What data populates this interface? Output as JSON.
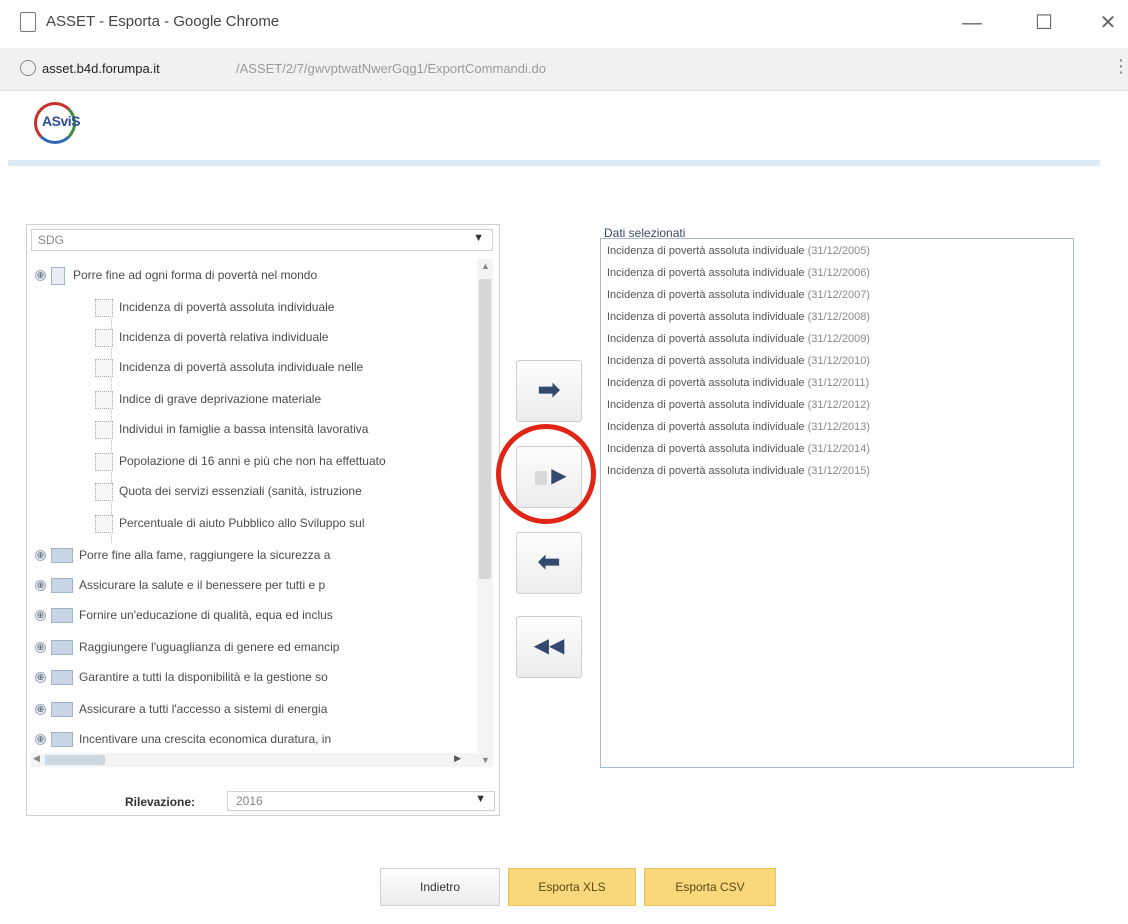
{
  "window": {
    "title": "ASSET - Esporta - Google Chrome",
    "minimize": "—",
    "maximize": "☐",
    "close": "✕"
  },
  "address": {
    "host": "asset.b4d.forumpa.it",
    "path": "/ASSET/2/7/gwvptwatNwerGqg1/ExportCommandi.do",
    "menu": "⋮"
  },
  "logo": {
    "text": "ASviS",
    "sub": ""
  },
  "left": {
    "group_select": "SDG",
    "tree": [
      {
        "type": "goal",
        "label": "Porre fine ad ogni forma di povertà nel mondo",
        "expander": "⊕"
      },
      {
        "type": "leaf",
        "label": "Incidenza di povertà assoluta individuale"
      },
      {
        "type": "leaf",
        "label": "Incidenza di povertà relativa individuale"
      },
      {
        "type": "leaf",
        "label": "Incidenza di povertà assoluta individuale nelle"
      },
      {
        "type": "leaf",
        "label": "Indice di grave deprivazione materiale"
      },
      {
        "type": "leaf",
        "label": "Individui in famiglie a bassa intensità lavorativa"
      },
      {
        "type": "leaf",
        "label": "Popolazione di 16 anni e più che non ha effettuato"
      },
      {
        "type": "leaf",
        "label": "Quota dei servizi essenziali (sanità, istruzione"
      },
      {
        "type": "leaf",
        "label": "Percentuale di aiuto Pubblico allo Sviluppo sul"
      },
      {
        "type": "goal",
        "label": "Porre fine alla fame, raggiungere la sicurezza a",
        "expander": "⊕"
      },
      {
        "type": "goal",
        "label": "Assicurare la salute e il benessere per tutti e p",
        "expander": "⊕"
      },
      {
        "type": "goal",
        "label": "Fornire un'educazione di qualità, equa ed inclus",
        "expander": "⊕"
      },
      {
        "type": "goal",
        "label": "Raggiungere l'uguaglianza di genere ed emancip",
        "expander": "⊕"
      },
      {
        "type": "goal",
        "label": "Garantire a tutti la disponibilità e la gestione so",
        "expander": "⊕"
      },
      {
        "type": "goal",
        "label": "Assicurare a tutti l'accesso a sistemi di energia",
        "expander": "⊕"
      },
      {
        "type": "goal",
        "label": "Incentivare una crescita economica duratura, in",
        "expander": "⊕"
      }
    ],
    "rilevazione_label": "Rilevazione:",
    "rilevazione_value": "2016"
  },
  "middle": {
    "add_icon": "➡",
    "add_all_icon": "▶",
    "remove_icon": "⬅",
    "remove_all_icon": "◀◀"
  },
  "right": {
    "title": "Dati selezionati",
    "items": [
      {
        "name": "Incidenza di povertà assoluta individuale",
        "date": "(31/12/2005)"
      },
      {
        "name": "Incidenza di povertà assoluta individuale",
        "date": "(31/12/2006)"
      },
      {
        "name": "Incidenza di povertà assoluta individuale",
        "date": "(31/12/2007)"
      },
      {
        "name": "Incidenza di povertà assoluta individuale",
        "date": "(31/12/2008)"
      },
      {
        "name": "Incidenza di povertà assoluta individuale",
        "date": "(31/12/2009)"
      },
      {
        "name": "Incidenza di povertà assoluta individuale",
        "date": "(31/12/2010)"
      },
      {
        "name": "Incidenza di povertà assoluta individuale",
        "date": "(31/12/2011)"
      },
      {
        "name": "Incidenza di povertà assoluta individuale",
        "date": "(31/12/2012)"
      },
      {
        "name": "Incidenza di povertà assoluta individuale",
        "date": "(31/12/2013)"
      },
      {
        "name": "Incidenza di povertà assoluta individuale",
        "date": "(31/12/2014)"
      },
      {
        "name": "Incidenza di povertà assoluta individuale",
        "date": "(31/12/2015)"
      }
    ]
  },
  "buttons": {
    "back": "Indietro",
    "export_xls": "Esporta XLS",
    "export_csv": "Esporta CSV"
  },
  "colors": {
    "accent_yellow": "#f8d87a",
    "arrow_navy": "#34496e",
    "highlight_red": "#e02515"
  }
}
